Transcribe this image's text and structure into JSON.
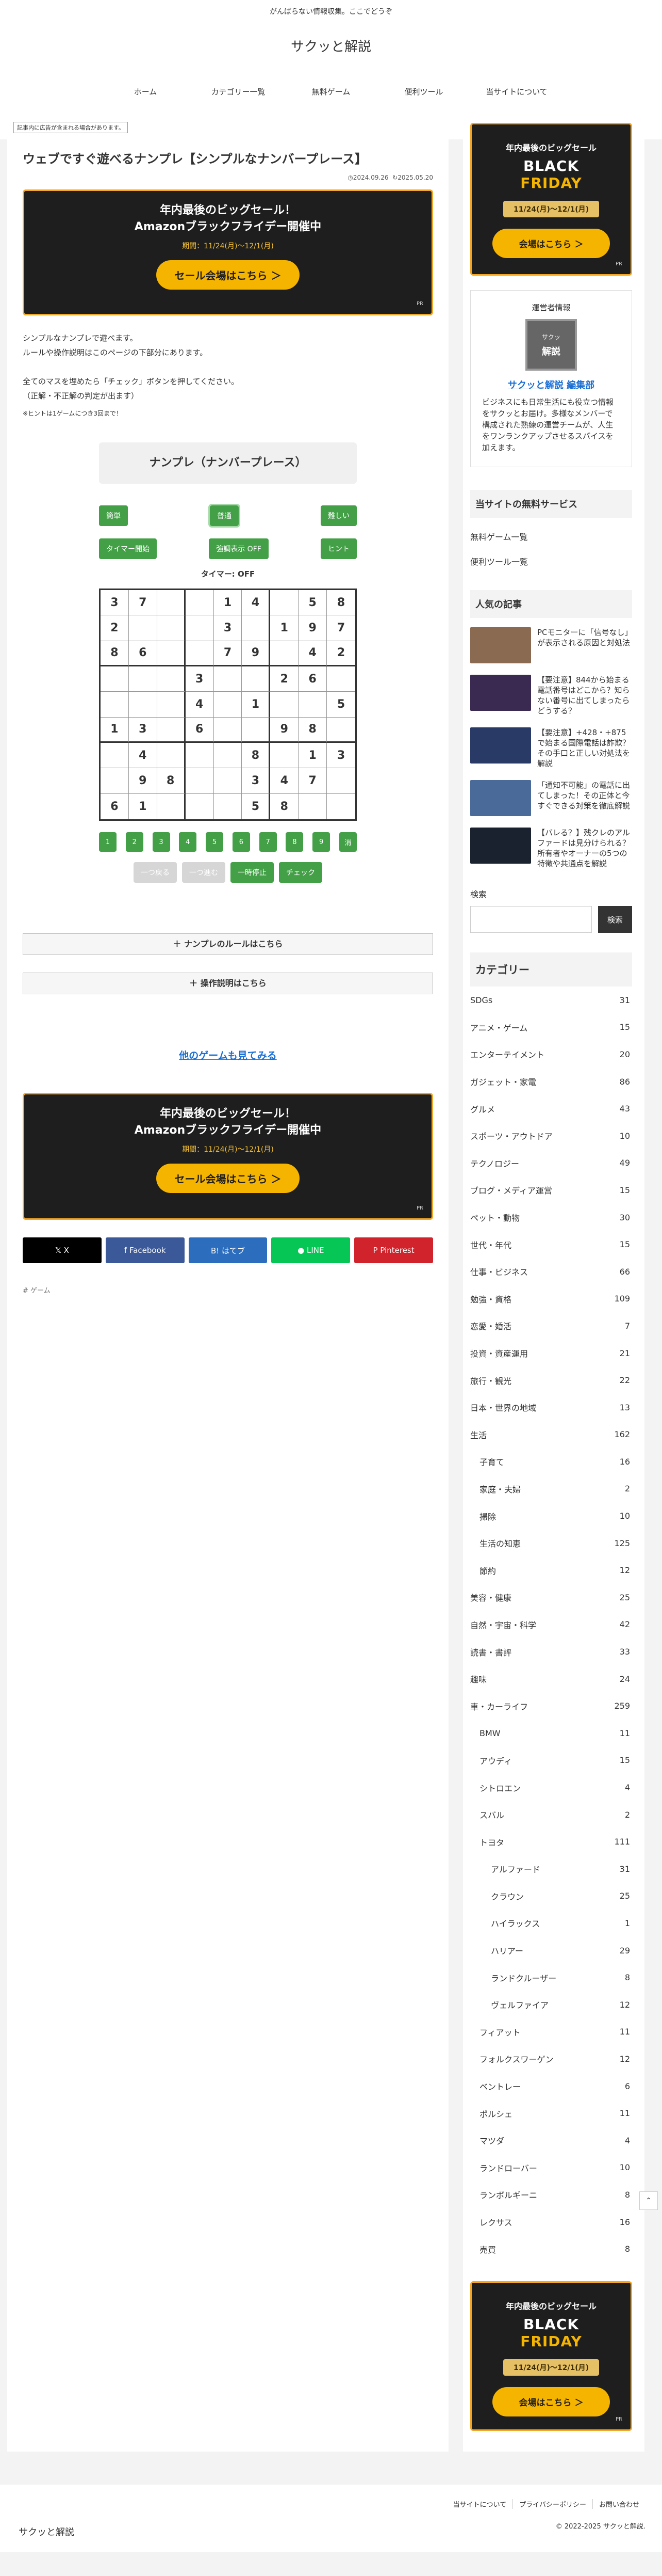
{
  "header": {
    "tagline": "がんばらない情報収集。ここでどうぞ",
    "site_title": "サクッと解説",
    "nav": [
      "ホーム",
      "カテゴリー一覧",
      "無料ゲーム",
      "便利ツール",
      "当サイトについて"
    ]
  },
  "article": {
    "pr_note": "記事内に広告が含まれる場合があります。",
    "title": "ウェブですぐ遊べるナンプレ【シンプルなナンバープレース】",
    "published": "2024.09.26",
    "updated": "2025.05.20",
    "intro_1a": "シンプルなナンプレで遊べます。",
    "intro_1b": "ルールや操作説明はこのページの下部分にあります。",
    "intro_2a": "全てのマスを埋めたら「チェック」ボタンを押してください。",
    "intro_2b": "（正解・不正解の判定が出ます）",
    "hint_note": "※ヒントは1ゲームにつき3回まで！"
  },
  "ad": {
    "line1": "年内最後のビッグセール！",
    "line2": "Amazonブラックフライデー開催中",
    "period": "期間：11/24(月)〜12/1(月)",
    "button": "セール会場はこちら ＞",
    "pr": "PR"
  },
  "game": {
    "title": "ナンプレ（ナンバープレース）",
    "difficulty": [
      "簡単",
      "普通",
      "難しい"
    ],
    "controls": [
      "タイマー開始",
      "強調表示 OFF",
      "ヒント"
    ],
    "timer": "タイマー: OFF",
    "numbers": [
      "1",
      "2",
      "3",
      "4",
      "5",
      "6",
      "7",
      "8",
      "9",
      "消"
    ],
    "actions": [
      "一つ戻る",
      "一つ進む",
      "一時停止",
      "チェック"
    ],
    "board": [
      [
        "3",
        "7",
        "",
        "",
        "1",
        "4",
        "",
        "5",
        "8"
      ],
      [
        "2",
        "",
        "",
        "",
        "3",
        "",
        "1",
        "9",
        "7"
      ],
      [
        "8",
        "6",
        "",
        "",
        "7",
        "9",
        "",
        "4",
        "2"
      ],
      [
        "",
        "",
        "",
        "3",
        "",
        "",
        "2",
        "6",
        ""
      ],
      [
        "",
        "",
        "",
        "4",
        "",
        "1",
        "",
        "",
        "5"
      ],
      [
        "1",
        "3",
        "",
        "6",
        "",
        "",
        "9",
        "8",
        ""
      ],
      [
        "",
        "4",
        "",
        "",
        "",
        "8",
        "",
        "1",
        "3"
      ],
      [
        "",
        "9",
        "8",
        "",
        "",
        "3",
        "4",
        "7",
        ""
      ],
      [
        "6",
        "1",
        "",
        "",
        "",
        "5",
        "8",
        "",
        ""
      ]
    ],
    "rules_toggle": "＋ ナンプレのルールはこちら",
    "howto_toggle": "＋ 操作説明はこちら",
    "more_games": "他のゲームも見てみる"
  },
  "share": {
    "buttons": [
      {
        "label": "𝕏  X",
        "color": "#000000"
      },
      {
        "label": "f  Facebook",
        "color": "#3b5998"
      },
      {
        "label": "B!  はてブ",
        "color": "#2c6ebd"
      },
      {
        "label": "●  LINE",
        "color": "#06c755"
      },
      {
        "label": "P  Pinterest",
        "color": "#d1232b"
      }
    ],
    "tag": "# ゲーム"
  },
  "sidebar": {
    "bf": {
      "line1": "年内最後のビッグセール",
      "black": "BLACK",
      "friday": "FRIDAY",
      "dates": "11/24(月)〜12/1(月)",
      "button": "会場はこちら ＞",
      "pr": "PR"
    },
    "author": {
      "heading": "運営者情報",
      "avatar_top": "サクッ",
      "avatar_bottom": "解説",
      "name": "サクッと解説 編集部",
      "desc": "ビジネスにも日常生活にも役立つ情報をサクッとお届け。多様なメンバーで構成された熟練の運営チームが、人生をワンランクアップさせるスパイスを加えます。"
    },
    "free_services_h": "当サイトの無料サービス",
    "free_services": [
      "無料ゲーム一覧",
      "便利ツール一覧"
    ],
    "popular_h": "人気の記事",
    "popular": [
      {
        "title": "PCモニターに「信号なし」が表示される原因と対処法",
        "color": "#8a6a50"
      },
      {
        "title": "【要注意】844から始まる電話番号はどこから？知らない番号に出てしまったらどうする？",
        "color": "#3a2a52"
      },
      {
        "title": "【要注意】+428・+875で始まる国際電話は詐欺？その手口と正しい対処法を解説",
        "color": "#2a3a66"
      },
      {
        "title": "「通知不可能」の電話に出てしまった！その正体と今すぐできる対策を徹底解説",
        "color": "#4a6a9a"
      },
      {
        "title": "【バレる？】残クレのアルファードは見分けられる？所有者やオーナーの5つの特徴や共通点を解説",
        "color": "#1a2230"
      }
    ],
    "search_label": "検索",
    "search_button": "検索",
    "categories_h": "カテゴリー",
    "categories": [
      {
        "name": "SDGs",
        "count": "31",
        "level": 0
      },
      {
        "name": "アニメ・ゲーム",
        "count": "15",
        "level": 0
      },
      {
        "name": "エンターテイメント",
        "count": "20",
        "level": 0
      },
      {
        "name": "ガジェット・家電",
        "count": "86",
        "level": 0
      },
      {
        "name": "グルメ",
        "count": "43",
        "level": 0
      },
      {
        "name": "スポーツ・アウトドア",
        "count": "10",
        "level": 0
      },
      {
        "name": "テクノロジー",
        "count": "49",
        "level": 0
      },
      {
        "name": "ブログ・メディア運営",
        "count": "15",
        "level": 0
      },
      {
        "name": "ペット・動物",
        "count": "30",
        "level": 0
      },
      {
        "name": "世代・年代",
        "count": "15",
        "level": 0
      },
      {
        "name": "仕事・ビジネス",
        "count": "66",
        "level": 0
      },
      {
        "name": "勉強・資格",
        "count": "109",
        "level": 0
      },
      {
        "name": "恋愛・婚活",
        "count": "7",
        "level": 0
      },
      {
        "name": "投資・資産運用",
        "count": "21",
        "level": 0
      },
      {
        "name": "旅行・観光",
        "count": "22",
        "level": 0
      },
      {
        "name": "日本・世界の地域",
        "count": "13",
        "level": 0
      },
      {
        "name": "生活",
        "count": "162",
        "level": 0
      },
      {
        "name": "子育て",
        "count": "16",
        "level": 1
      },
      {
        "name": "家庭・夫婦",
        "count": "2",
        "level": 1
      },
      {
        "name": "掃除",
        "count": "10",
        "level": 1
      },
      {
        "name": "生活の知恵",
        "count": "125",
        "level": 1
      },
      {
        "name": "節約",
        "count": "12",
        "level": 1
      },
      {
        "name": "美容・健康",
        "count": "25",
        "level": 0
      },
      {
        "name": "自然・宇宙・科学",
        "count": "42",
        "level": 0
      },
      {
        "name": "読書・書評",
        "count": "33",
        "level": 0
      },
      {
        "name": "趣味",
        "count": "24",
        "level": 0
      },
      {
        "name": "車・カーライフ",
        "count": "259",
        "level": 0
      },
      {
        "name": "BMW",
        "count": "11",
        "level": 1
      },
      {
        "name": "アウディ",
        "count": "15",
        "level": 1
      },
      {
        "name": "シトロエン",
        "count": "4",
        "level": 1
      },
      {
        "name": "スバル",
        "count": "2",
        "level": 1
      },
      {
        "name": "トヨタ",
        "count": "111",
        "level": 1
      },
      {
        "name": "アルファード",
        "count": "31",
        "level": 2
      },
      {
        "name": "クラウン",
        "count": "25",
        "level": 2
      },
      {
        "name": "ハイラックス",
        "count": "1",
        "level": 2
      },
      {
        "name": "ハリアー",
        "count": "29",
        "level": 2
      },
      {
        "name": "ランドクルーザー",
        "count": "8",
        "level": 2
      },
      {
        "name": "ヴェルファイア",
        "count": "12",
        "level": 2
      },
      {
        "name": "フィアット",
        "count": "11",
        "level": 1
      },
      {
        "name": "フォルクスワーゲン",
        "count": "12",
        "level": 1
      },
      {
        "name": "ベントレー",
        "count": "6",
        "level": 1
      },
      {
        "name": "ポルシェ",
        "count": "11",
        "level": 1
      },
      {
        "name": "マツダ",
        "count": "4",
        "level": 1
      },
      {
        "name": "ランドローバー",
        "count": "10",
        "level": 1
      },
      {
        "name": "ランボルギーニ",
        "count": "8",
        "level": 1
      },
      {
        "name": "レクサス",
        "count": "16",
        "level": 1
      },
      {
        "name": "売買",
        "count": "8",
        "level": 1
      }
    ]
  },
  "footer": {
    "links": [
      "当サイトについて",
      "プライバシーポリシー",
      "お問い合わせ"
    ],
    "copyright": "© 2022-2025 サクッと解説.",
    "logo": "サクッと解説"
  },
  "page_top_icon": "chevron-up-icon"
}
